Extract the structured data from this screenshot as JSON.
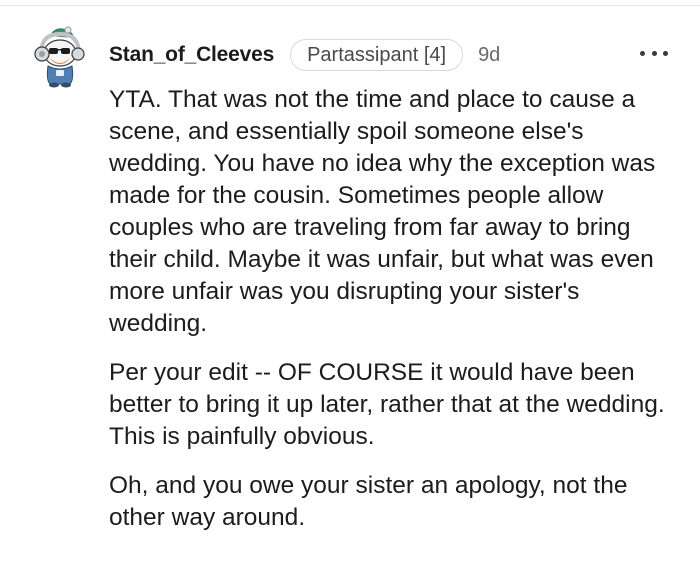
{
  "comment": {
    "author": "Stan_of_Cleeves",
    "flair": "Partassipant [4]",
    "timestamp": "9d",
    "more_icon": "more-horizontal-icon",
    "avatar_icon": "snoo-avatar-icon",
    "paragraphs": [
      "YTA. That was not the time and place to cause a scene, and essentially spoil someone else's wedding. You have no idea why the exception was made for the cousin. Sometimes people allow couples who are traveling from far away to bring their child. Maybe it was unfair, but what was even more unfair was you disrupting your sister's wedding.",
      "Per your edit -- OF COURSE it would have been better to bring it up later, rather that at the wedding. This is painfully obvious.",
      "Oh, and you owe your sister an apology, not the other way around."
    ]
  },
  "colors": {
    "background": "#ffffff",
    "text": "#1c1c1c",
    "muted": "#6a6a6a",
    "flair_border": "#d9d9d9"
  }
}
